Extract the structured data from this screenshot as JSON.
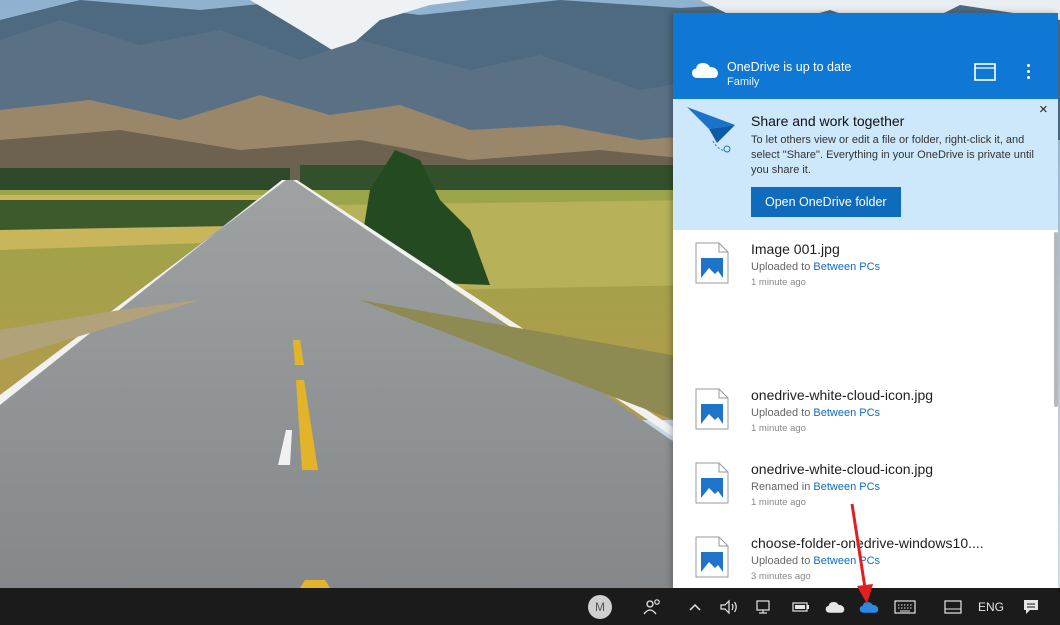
{
  "flyout": {
    "title": "OneDrive is up to date",
    "subtitle": "Family",
    "header_icons": [
      "onedrive-cloud-icon",
      "folder-icon",
      "more-options-icon"
    ]
  },
  "promo": {
    "title": "Share and work together",
    "text": "To let others view or edit a file or folder, right-click it, and select \"Share\". Everything in your OneDrive is private until you share it.",
    "button_label": "Open OneDrive folder",
    "close_label": "×"
  },
  "activity": [
    {
      "name": "Image 001.jpg",
      "action": "Uploaded to ",
      "location": "Between PCs",
      "time": "1 minute ago"
    },
    {
      "name": "onedrive-white-cloud-icon.jpg",
      "action": "Uploaded to ",
      "location": "Between PCs",
      "time": "1 minute ago"
    },
    {
      "name": "onedrive-white-cloud-icon.jpg",
      "action": "Renamed in ",
      "location": "Between PCs",
      "time": "1 minute ago"
    },
    {
      "name": "choose-folder-onedrive-windows10....",
      "action": "Uploaded to ",
      "location": "Between PCs",
      "time": "3 minutes ago"
    }
  ],
  "taskbar": {
    "avatar_letter": "M",
    "language": "ENG",
    "icons": [
      "people-icon",
      "chevron-up-icon",
      "volume-icon",
      "network-icon",
      "battery-icon",
      "onedrive-white-icon",
      "onedrive-blue-icon",
      "keyboard-icon",
      "tablet-icon",
      "notifications-icon"
    ]
  },
  "colors": {
    "header_blue": "#0f78d4",
    "promo_bg": "#cde8fb",
    "button_blue": "#0f6cbd",
    "link_blue": "#0f6cbd",
    "taskbar": "#1b1b1b",
    "arrow_red": "#e02020"
  }
}
